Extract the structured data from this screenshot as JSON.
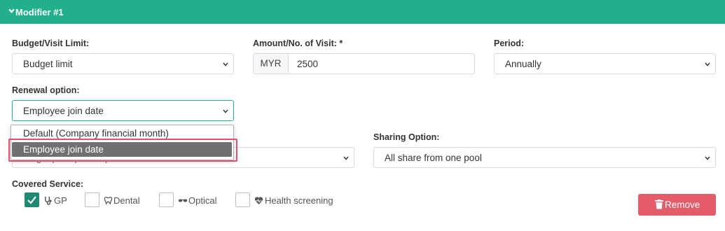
{
  "header": {
    "title": "Modifier #1"
  },
  "budget": {
    "label": "Budget/Visit Limit:",
    "value": "Budget limit"
  },
  "amount": {
    "label": "Amount/No. of Visit: *",
    "currency": "MYR",
    "value": "2500"
  },
  "period": {
    "label": "Period:",
    "value": "Annually"
  },
  "renewal": {
    "label": "Renewal option:",
    "value": "Employee join date",
    "options": [
      "Default (Company financial month)",
      "Employee join date"
    ],
    "selected_index": 1
  },
  "target": {
    "value": "Target principals dependants"
  },
  "sharing": {
    "label": "Sharing Option:",
    "value": "All share from one pool"
  },
  "covered": {
    "label": "Covered Service:",
    "items": [
      {
        "label": "GP",
        "checked": true,
        "icon": "stethoscope-icon"
      },
      {
        "label": "Dental",
        "checked": false,
        "icon": "tooth-icon"
      },
      {
        "label": "Optical",
        "checked": false,
        "icon": "glasses-icon"
      },
      {
        "label": "Health screening",
        "checked": false,
        "icon": "heartbeat-icon"
      }
    ]
  },
  "remove_button": {
    "label": "Remove",
    "icon": "trash-icon"
  },
  "colors": {
    "header": "#22b08c",
    "checked": "#1f8a70",
    "remove": "#e45b6a",
    "highlight": "#e5506a"
  }
}
